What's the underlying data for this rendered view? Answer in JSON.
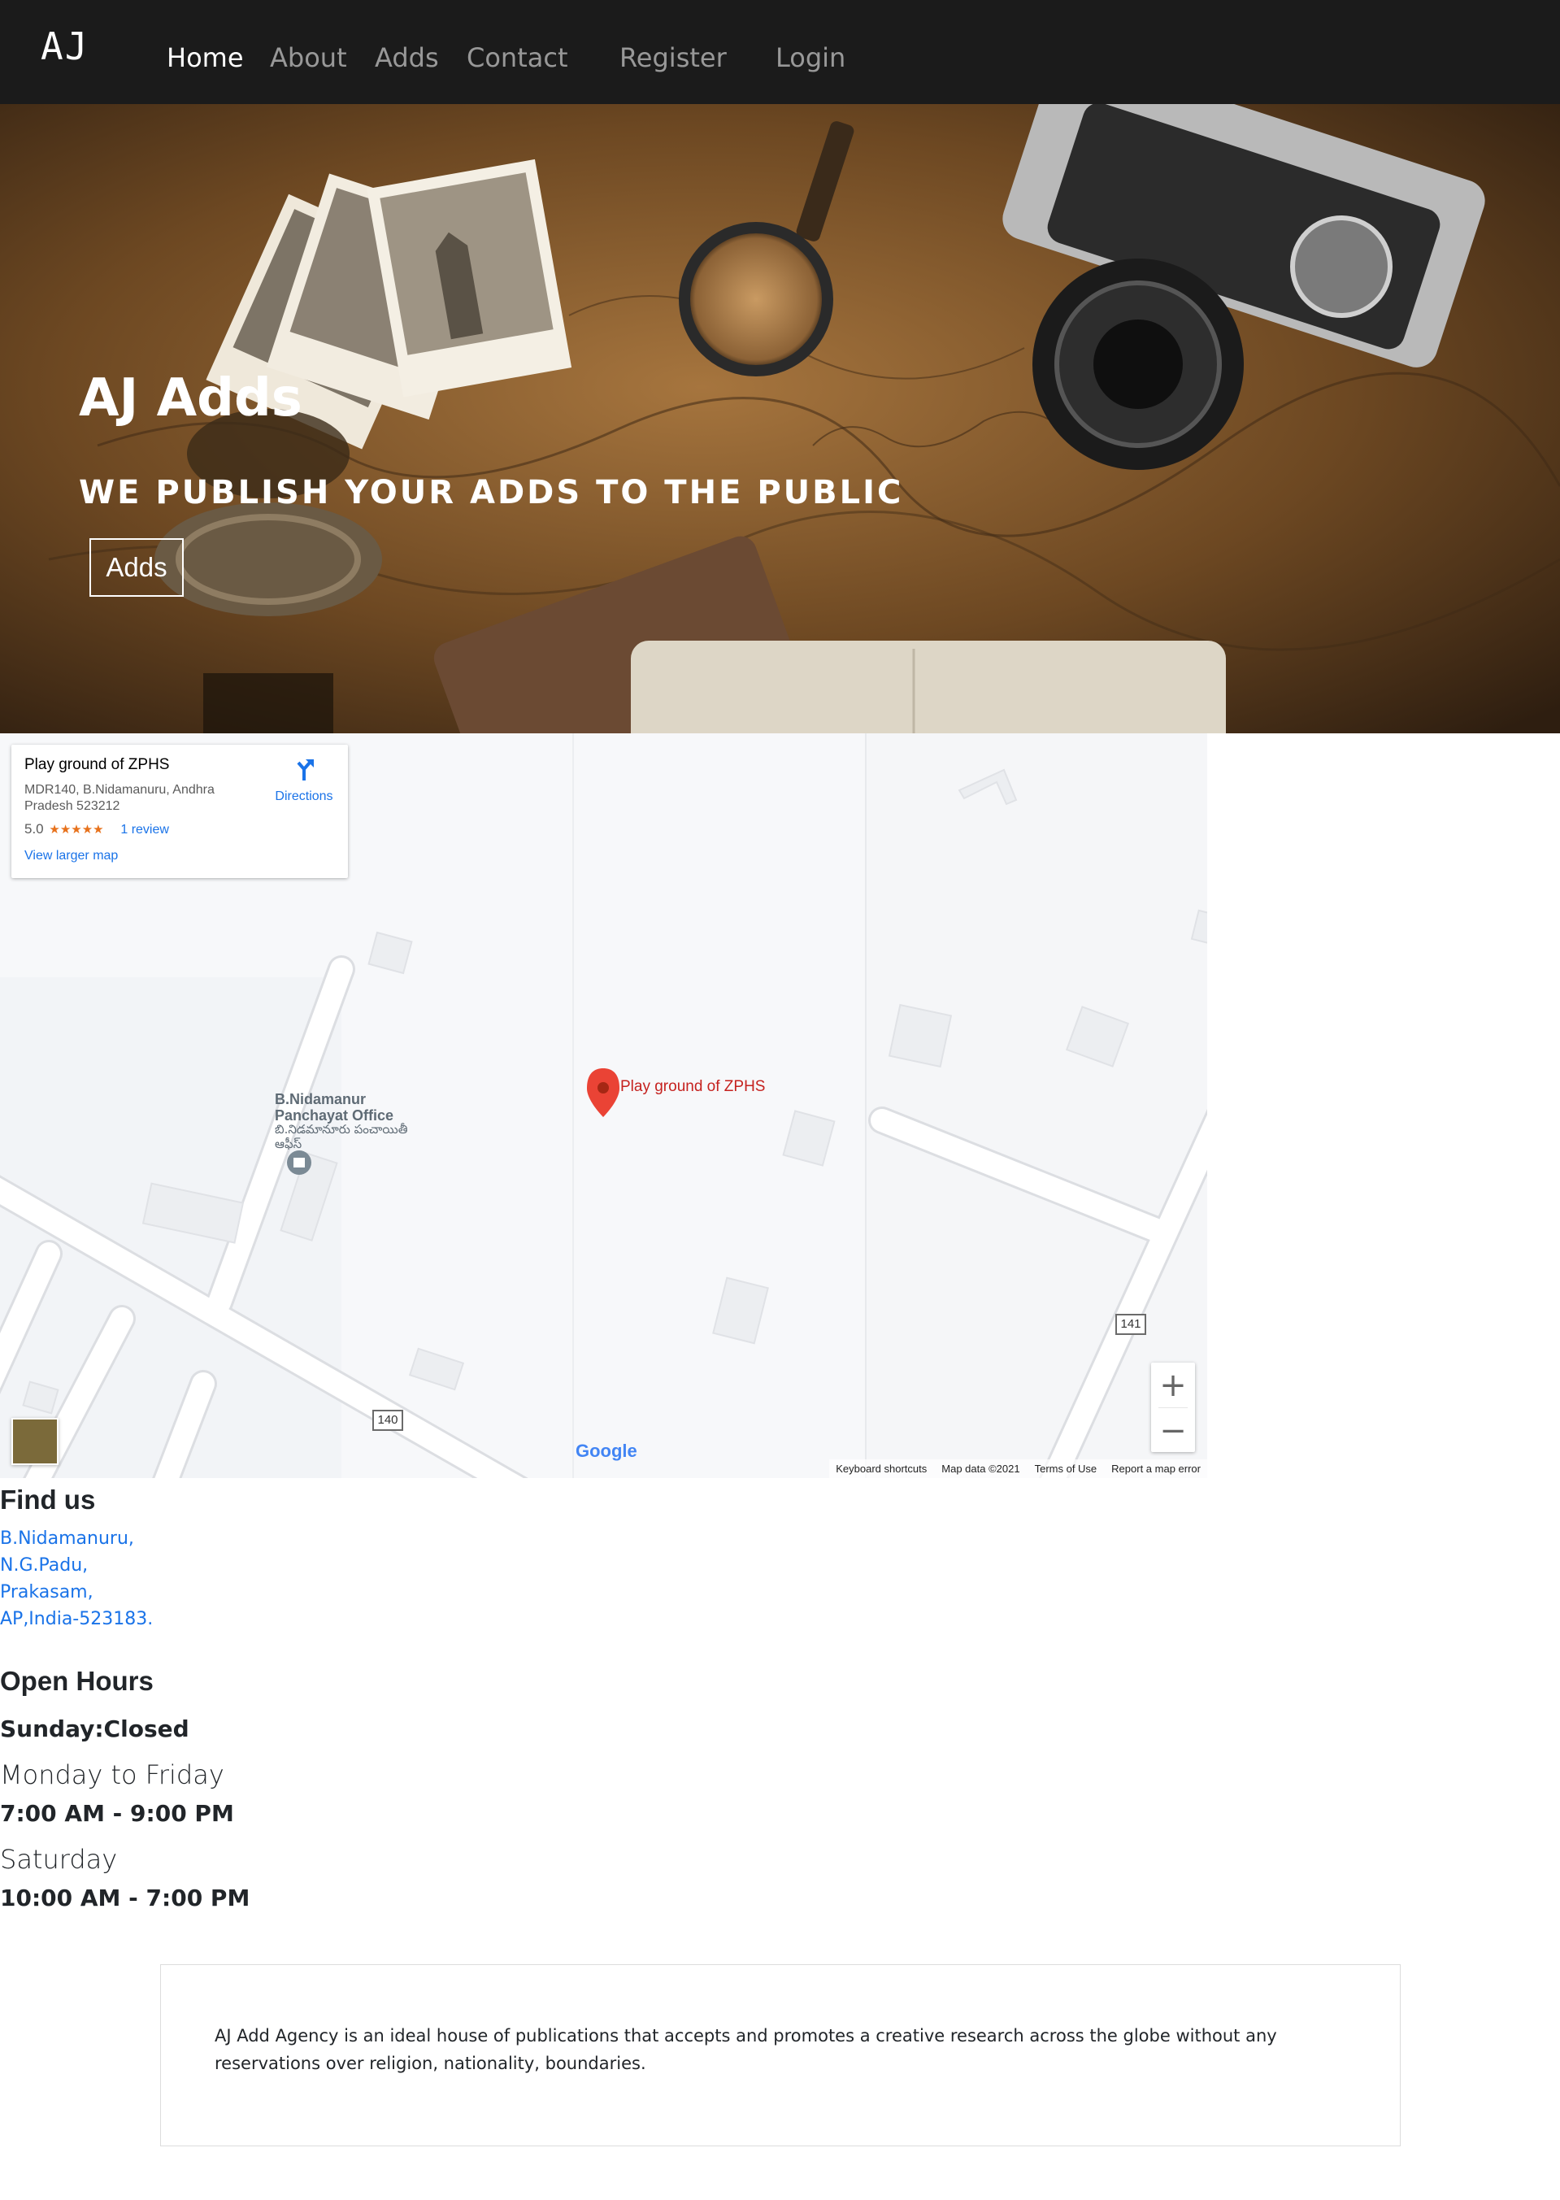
{
  "nav": {
    "brand": "AJ",
    "links": [
      {
        "label": "Home",
        "active": true
      },
      {
        "label": "About"
      },
      {
        "label": "Adds"
      },
      {
        "label": "Contact"
      },
      {
        "label": "Register"
      },
      {
        "label": "Login"
      }
    ]
  },
  "hero": {
    "title": "AJ Adds",
    "subtitle": "WE PUBLISH YOUR ADDS TO THE PUBLIC",
    "button_label": "Adds"
  },
  "map": {
    "place_name": "Play ground of ZPHS",
    "address": "MDR140, B.Nidamanuru, Andhra Pradesh 523212",
    "rating": "5.0",
    "stars": "★★★★★",
    "review_link": "1 review",
    "directions_label": "Directions",
    "larger_map_link": "View larger map",
    "pin_label": "Play ground of ZPHS",
    "poi_name": "B.Nidamanur Panchayat Office",
    "poi_local": "బి.నిడమానూరు పంచాయితీ ఆఫీస్",
    "road_shields": [
      "141",
      "140"
    ],
    "zoom_in": "+",
    "zoom_out": "−",
    "logo_text": "Google",
    "footer_links": [
      "Keyboard shortcuts",
      "Map data ©2021",
      "Terms of Use",
      "Report a map error"
    ]
  },
  "find_us": {
    "heading": "Find us",
    "lines": [
      "B.Nidamanuru,",
      "N.G.Padu,",
      "Prakasam,",
      "AP,India-523183."
    ]
  },
  "open_hours": {
    "heading": "Open Hours",
    "sunday": "Sunday:Closed",
    "weekday_label": "Monday to Friday",
    "weekday_hours": "7:00 AM - 9:00 PM",
    "saturday_label": "Saturday",
    "saturday_hours": "10:00 AM - 7:00 PM"
  },
  "about": {
    "text": "AJ Add Agency is an ideal house of publications that accepts and promotes a creative research across the globe without any reservations over religion, nationality, boundaries."
  }
}
